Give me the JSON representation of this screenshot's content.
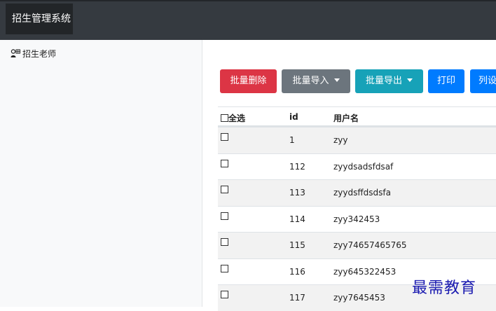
{
  "app": {
    "title": "招生管理系统"
  },
  "sidebar": {
    "items": [
      {
        "label": "招生老师",
        "icon": "user-table-icon"
      }
    ]
  },
  "toolbar": {
    "batch_delete": "批量删除",
    "batch_import": "批量导入",
    "batch_export": "批量导出",
    "print": "打印",
    "column_settings": "列设"
  },
  "table": {
    "headers": {
      "select_all": "全选",
      "id": "id",
      "username": "用户名"
    },
    "rows": [
      {
        "id": "1",
        "username": "zyy"
      },
      {
        "id": "112",
        "username": "zyydsadsfdsaf"
      },
      {
        "id": "113",
        "username": "zyydsffdsdsfa"
      },
      {
        "id": "114",
        "username": "zyy342453"
      },
      {
        "id": "115",
        "username": "zyy74657465765"
      },
      {
        "id": "116",
        "username": "zyy645322453"
      },
      {
        "id": "117",
        "username": "zyy7645453"
      }
    ]
  },
  "watermark": "最需教育",
  "colors": {
    "topbar": "#353a40",
    "danger": "#dc3545",
    "secondary": "#6c757d",
    "info": "#17a2b8",
    "primary": "#007bff"
  }
}
